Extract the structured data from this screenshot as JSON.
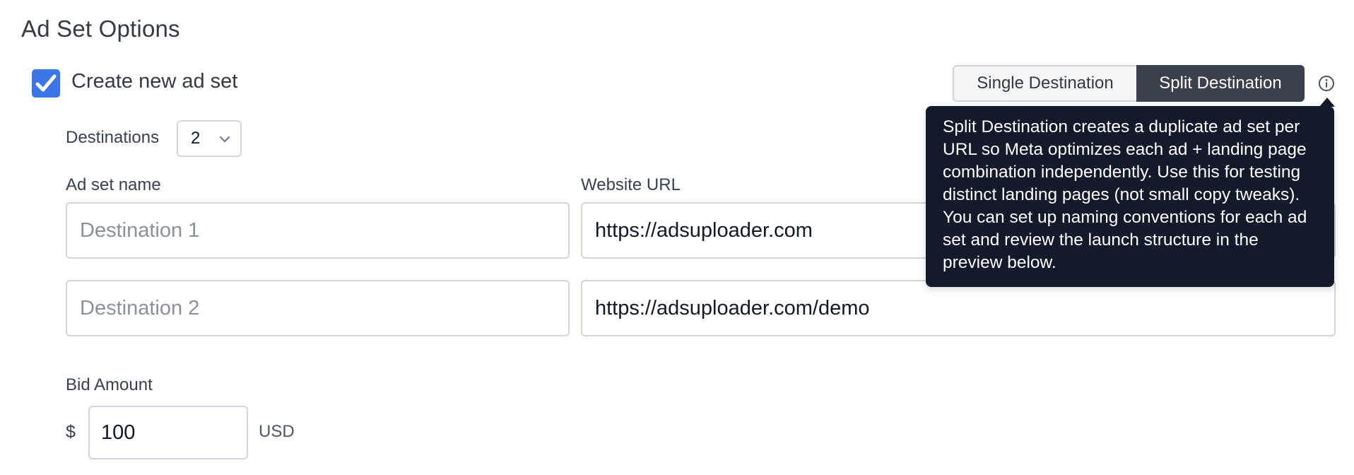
{
  "section": {
    "title": "Ad Set Options"
  },
  "create_ad_set": {
    "label": "Create new ad set",
    "checked": true
  },
  "destination_mode": {
    "single_label": "Single Destination",
    "split_label": "Split Destination",
    "selected": "Split Destination",
    "info_icon": "info-circle-icon"
  },
  "tooltip": {
    "text": "Split Destination creates a duplicate ad set per URL so Meta optimizes each ad + landing page combination independently. Use this for testing distinct landing pages (not small copy tweaks). You can set up naming conventions for each ad set and review the launch structure in the preview below."
  },
  "destinations": {
    "label": "Destinations",
    "value": "2"
  },
  "columns": {
    "ad_set_name": "Ad set name",
    "website_url": "Website URL"
  },
  "rows": [
    {
      "name_placeholder": "Destination 1",
      "url": "https://adsuploader.com"
    },
    {
      "name_placeholder": "Destination 2",
      "url": "https://adsuploader.com/demo"
    }
  ],
  "bid": {
    "label": "Bid Amount",
    "currency_symbol": "$",
    "value": "100",
    "currency_code": "USD"
  },
  "colors": {
    "accent": "#3b75e8",
    "toggle_active": "#3a414d",
    "tooltip_bg": "#131a2b"
  }
}
